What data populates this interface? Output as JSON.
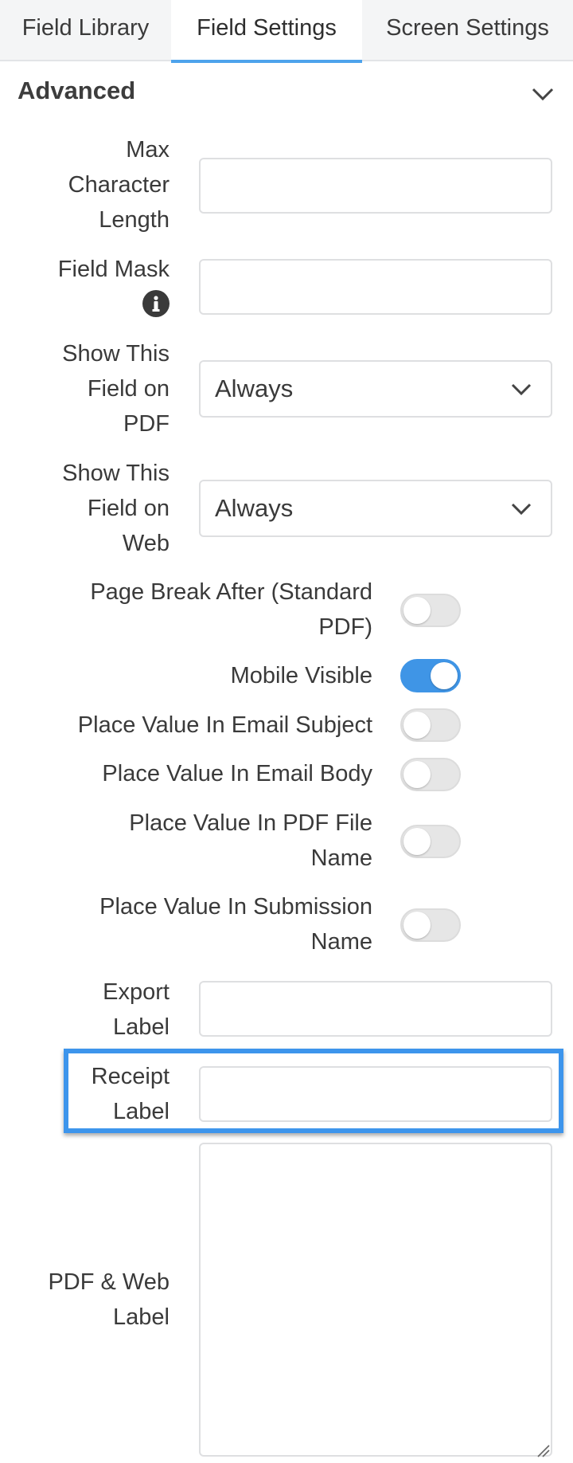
{
  "tabs": [
    {
      "label": "Field Library",
      "active": false
    },
    {
      "label": "Field Settings",
      "active": true
    },
    {
      "label": "Screen Settings",
      "active": false
    }
  ],
  "section": {
    "title": "Advanced",
    "icon": "chevron-down-icon"
  },
  "fields": {
    "max_char_length": {
      "label_lines": [
        "Max",
        "Character",
        "Length"
      ],
      "value": ""
    },
    "field_mask": {
      "label": "Field Mask",
      "icon": "info-icon",
      "value": ""
    },
    "show_on_pdf": {
      "label_lines": [
        "Show This",
        "Field on",
        "PDF"
      ],
      "value": "Always"
    },
    "show_on_web": {
      "label_lines": [
        "Show This",
        "Field on",
        "Web"
      ],
      "value": "Always"
    },
    "export_label": {
      "label_lines": [
        "Export",
        "Label"
      ],
      "value": ""
    },
    "receipt_label": {
      "label_lines": [
        "Receipt",
        "Label"
      ],
      "value": ""
    },
    "pdf_web_label": {
      "label_lines": [
        "PDF & Web",
        "Label"
      ],
      "value": ""
    }
  },
  "toggles": {
    "page_break_after": {
      "label_lines": [
        "Page Break After (Standard",
        "PDF)"
      ],
      "on": false
    },
    "mobile_visible": {
      "label": "Mobile Visible",
      "on": true
    },
    "email_subject": {
      "label": "Place Value In Email Subject",
      "on": false
    },
    "email_body": {
      "label": "Place Value In Email Body",
      "on": false
    },
    "pdf_file_name": {
      "label_lines": [
        "Place Value In PDF File",
        "Name"
      ],
      "on": false
    },
    "submission_name": {
      "label_lines": [
        "Place Value In Submission",
        "Name"
      ],
      "on": false
    }
  },
  "colors": {
    "accent": "#3f95e6",
    "highlight": "#3d95ec",
    "toggle_off": "#e6e6e6"
  }
}
